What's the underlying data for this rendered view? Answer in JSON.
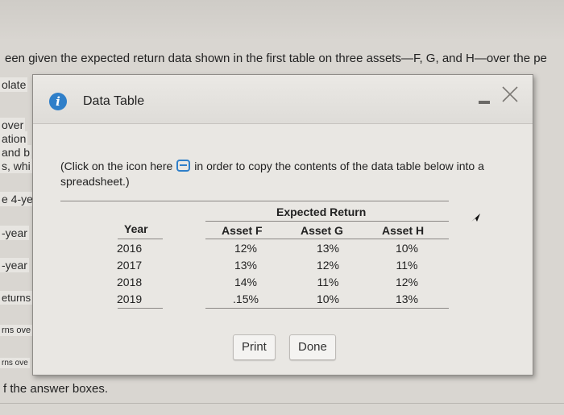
{
  "page": {
    "question_text": "een given the expected return data shown in the first table on three assets—F, G, and H—over the pe",
    "behind_labels": [
      "olate",
      "over",
      "ation",
      "and b",
      "s, whi",
      "e 4-ye",
      "-year",
      "-year",
      "eturns",
      "rns ove",
      "rns ove"
    ],
    "footer_text": "f the answer boxes."
  },
  "modal": {
    "title": "Data Table",
    "instruction_part1": "(Click on the icon here",
    "instruction_part2": "in order to copy the contents of the data table below into a spreadsheet.)",
    "table": {
      "group_header": "Expected Return",
      "year_header": "Year",
      "columns": [
        "Asset F",
        "Asset G",
        "Asset H"
      ],
      "rows": [
        {
          "year": "2016",
          "values": [
            "12%",
            "13%",
            "10%"
          ]
        },
        {
          "year": "2017",
          "values": [
            "13%",
            "12%",
            "11%"
          ]
        },
        {
          "year": "2018",
          "values": [
            "14%",
            "11%",
            "12%"
          ]
        },
        {
          "year": "2019",
          "values": [
            ".15%",
            "10%",
            "13%"
          ]
        }
      ]
    },
    "buttons": {
      "print": "Print",
      "done": "Done"
    }
  },
  "icons": {
    "info": "info-icon",
    "copy": "copy-spreadsheet-icon",
    "minimize": "minimize-icon",
    "close": "close-icon",
    "cursor": "mouse-cursor-icon"
  },
  "colors": {
    "accent": "#2f7fc9",
    "modal_bg": "#e9e7e3",
    "page_bg": "#d9d6d1"
  }
}
